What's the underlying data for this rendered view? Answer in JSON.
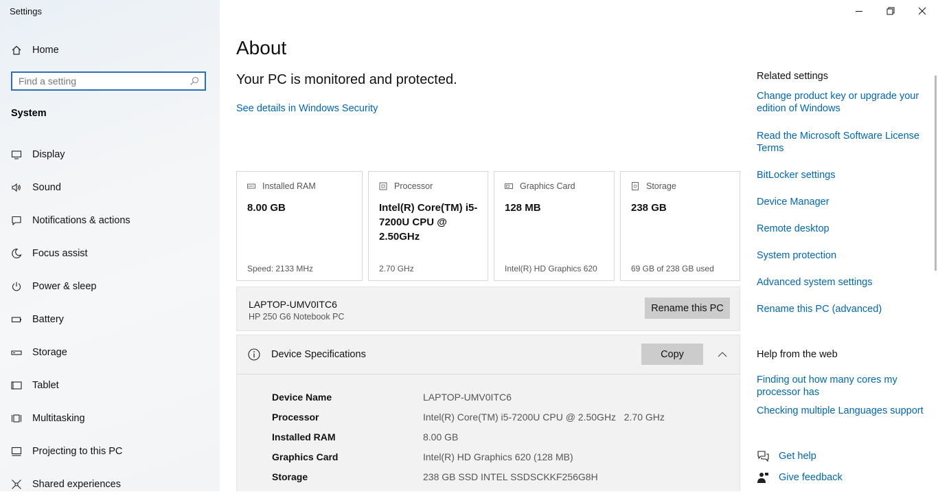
{
  "window": {
    "title": "Settings",
    "controls": [
      "minimize",
      "restore",
      "close"
    ]
  },
  "sidebar": {
    "home_label": "Home",
    "search_placeholder": "Find a setting",
    "section_heading": "System",
    "items": [
      {
        "label": "Display",
        "icon": "display-icon"
      },
      {
        "label": "Sound",
        "icon": "sound-icon"
      },
      {
        "label": "Notifications & actions",
        "icon": "notifications-icon"
      },
      {
        "label": "Focus assist",
        "icon": "focus-assist-icon"
      },
      {
        "label": "Power & sleep",
        "icon": "power-icon"
      },
      {
        "label": "Battery",
        "icon": "battery-icon"
      },
      {
        "label": "Storage",
        "icon": "storage-icon"
      },
      {
        "label": "Tablet",
        "icon": "tablet-icon"
      },
      {
        "label": "Multitasking",
        "icon": "multitasking-icon"
      },
      {
        "label": "Projecting to this PC",
        "icon": "projecting-icon"
      },
      {
        "label": "Shared experiences",
        "icon": "shared-experiences-icon"
      }
    ]
  },
  "main": {
    "title": "About",
    "protection_status": "Your PC is monitored and protected.",
    "security_link": "See details in Windows Security",
    "cards": [
      {
        "label": "Installed RAM",
        "value": "8.00 GB",
        "detail": "Speed: 2133 MHz",
        "icon": "ram-icon"
      },
      {
        "label": "Processor",
        "value": "Intel(R) Core(TM) i5-7200U CPU @ 2.50GHz",
        "detail": "2.70 GHz",
        "icon": "processor-icon"
      },
      {
        "label": "Graphics Card",
        "value": "128 MB",
        "detail": "Intel(R) HD Graphics 620",
        "icon": "graphics-card-icon"
      },
      {
        "label": "Storage",
        "value": "238 GB",
        "detail": "69 GB of 238 GB used",
        "icon": "storage-drive-icon"
      }
    ],
    "pc": {
      "name": "LAPTOP-UMV0ITC6",
      "model": "HP 250 G6 Notebook PC",
      "rename_label": "Rename this PC"
    },
    "device_specs": {
      "title": "Device Specifications",
      "copy_label": "Copy",
      "rows": [
        {
          "label": "Device Name",
          "value": "LAPTOP-UMV0ITC6"
        },
        {
          "label": "Processor",
          "value": "Intel(R) Core(TM) i5-7200U CPU @ 2.50GHz   2.70 GHz"
        },
        {
          "label": "Installed RAM",
          "value": "8.00 GB"
        },
        {
          "label": "Graphics Card",
          "value": "Intel(R) HD Graphics 620 (128 MB)"
        },
        {
          "label": "Storage",
          "value": "238 GB SSD INTEL SSDSCKKF256G8H"
        }
      ]
    }
  },
  "related": {
    "heading": "Related settings",
    "links": [
      "Change product key or upgrade your edition of Windows",
      "Read the Microsoft Software License Terms",
      "BitLocker settings",
      "Device Manager",
      "Remote desktop",
      "System protection",
      "Advanced system settings",
      "Rename this PC (advanced)"
    ]
  },
  "help": {
    "heading": "Help from the web",
    "links": [
      "Finding out how many cores my processor has",
      "Checking multiple Languages support"
    ],
    "get_help": "Get help",
    "give_feedback": "Give feedback"
  },
  "colors": {
    "accent": "#0067b8",
    "search_border": "#2a6fb5",
    "button_gray": "#cccccc",
    "panel_gray": "#f2f2f2"
  }
}
